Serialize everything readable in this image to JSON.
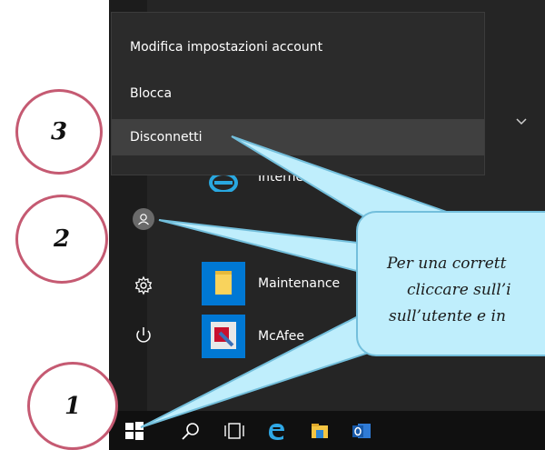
{
  "context_menu": {
    "items": [
      {
        "label": "Modifica impostazioni account"
      },
      {
        "label": "Blocca"
      },
      {
        "label": "Disconnetti"
      }
    ]
  },
  "apps": [
    {
      "label": "Internet Expl",
      "icon": "internet-explorer-icon"
    },
    {
      "label": "Maintenance",
      "icon": "folder-icon"
    },
    {
      "label": "McAfee",
      "icon": "mcafee-icon"
    }
  ],
  "steps": {
    "one": "1",
    "two": "2",
    "three": "3"
  },
  "callout": {
    "line1": "Per una corrett",
    "line2": "cliccare sull’i",
    "line3": "sull’utente e in"
  },
  "colors": {
    "callout_fill": "#bfeefc",
    "callout_border": "#73bfdc",
    "circle_border": "#c55a72",
    "menu_bg": "#2b2b2b",
    "hover_bg": "#404040"
  },
  "taskbar": {
    "icons": [
      "windows-start-icon",
      "search-icon",
      "task-view-icon",
      "edge-icon",
      "file-explorer-icon",
      "outlook-icon"
    ]
  }
}
